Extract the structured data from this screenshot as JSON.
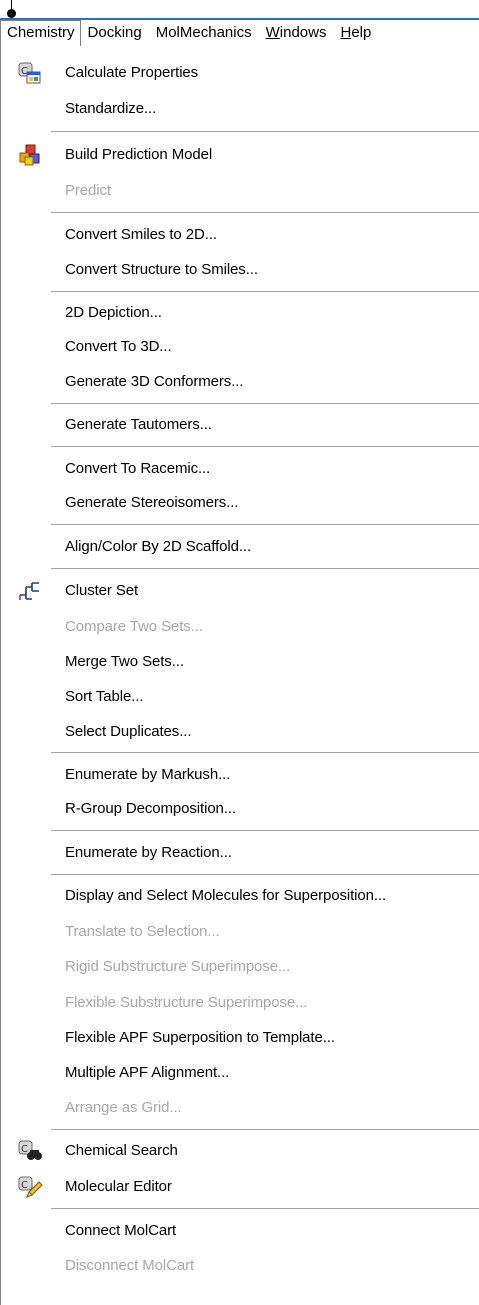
{
  "menubar": [
    {
      "label": "Chemistry",
      "active": true
    },
    {
      "label": "Docking"
    },
    {
      "label": "MolMechanics"
    },
    {
      "label_pre": "",
      "label_u": "W",
      "label_post": "indows"
    },
    {
      "label_pre": "",
      "label_u": "H",
      "label_post": "elp"
    }
  ],
  "menu": {
    "items": [
      {
        "label": "Calculate Properties",
        "icon": "calc-properties-icon"
      },
      {
        "label": "Standardize..."
      },
      {
        "label": "Build Prediction Model",
        "icon": "build-model-icon"
      },
      {
        "label": "Predict",
        "disabled": true
      },
      {
        "label": "Convert Smiles to 2D..."
      },
      {
        "label": "Convert Structure to Smiles..."
      },
      {
        "label": "2D Depiction..."
      },
      {
        "label": "Convert To 3D..."
      },
      {
        "label": "Generate 3D Conformers..."
      },
      {
        "label": "Generate Tautomers..."
      },
      {
        "label": "Convert To Racemic..."
      },
      {
        "label": "Generate Stereoisomers..."
      },
      {
        "label": "Align/Color By 2D Scaffold..."
      },
      {
        "label": "Cluster Set",
        "icon": "cluster-icon"
      },
      {
        "label": "Compare Two Sets...",
        "disabled": true
      },
      {
        "label": "Merge Two Sets..."
      },
      {
        "label": "Sort Table..."
      },
      {
        "label": "Select Duplicates..."
      },
      {
        "label": "Enumerate by Markush..."
      },
      {
        "label": "R-Group Decomposition..."
      },
      {
        "label": "Enumerate by Reaction..."
      },
      {
        "label": "Display and Select Molecules for Superposition..."
      },
      {
        "label": "Translate to Selection...",
        "disabled": true
      },
      {
        "label": "Rigid Substructure Superimpose...",
        "disabled": true
      },
      {
        "label": "Flexible Substructure Superimpose...",
        "disabled": true
      },
      {
        "label": "Flexible APF Superposition to Template..."
      },
      {
        "label": "Multiple APF Alignment..."
      },
      {
        "label": "Arrange as Grid...",
        "disabled": true
      },
      {
        "label": "Chemical Search",
        "icon": "chemical-search-icon"
      },
      {
        "label": "Molecular Editor",
        "icon": "molecular-editor-icon"
      },
      {
        "label": "Connect MolCart"
      },
      {
        "label": "Disconnect MolCart",
        "disabled": true
      }
    ]
  }
}
